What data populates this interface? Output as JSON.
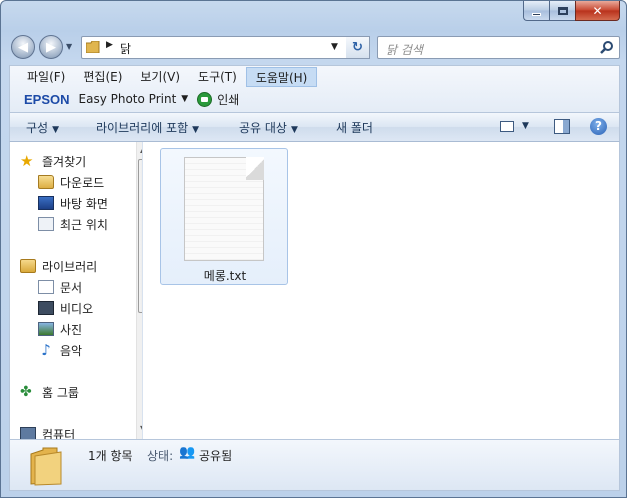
{
  "window": {
    "caption_buttons": {
      "minimize": "minimize-button",
      "maximize": "maximize-button",
      "close": "close-button"
    }
  },
  "navigation": {
    "address_path": "닭",
    "search_placeholder": "닭 검색"
  },
  "menu": {
    "items": [
      "파일(F)",
      "편집(E)",
      "보기(V)",
      "도구(T)",
      "도움말(H)"
    ],
    "active_index": 4
  },
  "epson": {
    "logo": "EPSON",
    "app": "Easy Photo Print",
    "print": "인쇄"
  },
  "command_bar": {
    "organize": "구성",
    "include_in_library": "라이브러리에 포함",
    "share_with": "공유 대상",
    "new_folder": "새 폴더"
  },
  "nav_pane": {
    "favorites": "즐겨찾기",
    "favorites_items": [
      "다운로드",
      "바탕 화면",
      "최근 위치"
    ],
    "libraries": "라이브러리",
    "libraries_items": [
      "문서",
      "비디오",
      "사진",
      "음악"
    ],
    "homegroup": "홈 그룹",
    "computer": "컴퓨터"
  },
  "files": [
    {
      "name": "메롱.txt",
      "icon": "text-file-icon"
    }
  ],
  "details": {
    "count": "1개 항목",
    "state_label": "상태:",
    "state_value": "공유됨"
  },
  "colors": {
    "accent": "#1c4aa7",
    "selection": "#e5effb",
    "frame": "#b9cfe9"
  }
}
